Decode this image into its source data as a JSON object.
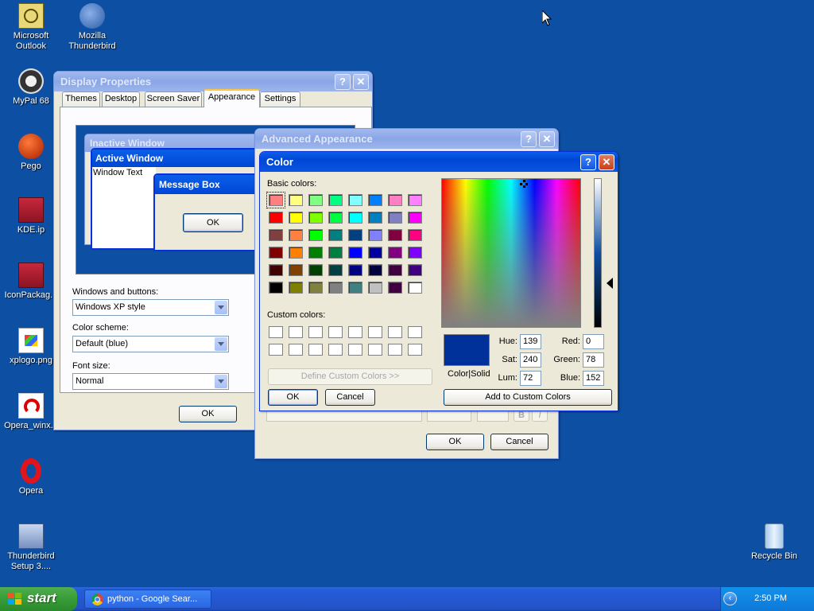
{
  "desktop": {
    "icons": [
      {
        "label": "Microsoft Outlook"
      },
      {
        "label": "Mozilla Thunderbird"
      },
      {
        "label": "MyPal 68"
      },
      {
        "label": "Pego"
      },
      {
        "label": "KDE.ip"
      },
      {
        "label": "IconPackag..."
      },
      {
        "label": "xplogo.png"
      },
      {
        "label": "Opera_winx..."
      },
      {
        "label": "Opera"
      },
      {
        "label": "Thunderbird Setup 3...."
      },
      {
        "label": "Recycle Bin"
      }
    ]
  },
  "display_properties": {
    "title": "Display Properties",
    "tabs": [
      "Themes",
      "Desktop",
      "Screen Saver",
      "Appearance",
      "Settings"
    ],
    "selected_tab": "Appearance",
    "preview": {
      "inactive_title": "Inactive Window",
      "active_title": "Active Window",
      "window_text": "Window Text",
      "message_box_title": "Message Box",
      "message_ok": "OK"
    },
    "windows_buttons_label": "Windows and buttons:",
    "windows_buttons_value": "Windows XP style",
    "color_scheme_label": "Color scheme:",
    "color_scheme_value": "Default (blue)",
    "font_size_label": "Font size:",
    "font_size_value": "Normal",
    "ok": "OK"
  },
  "advanced_appearance": {
    "title": "Advanced Appearance",
    "ok": "OK",
    "cancel": "Cancel",
    "bold_button": "B",
    "italic_button": "I"
  },
  "color_dialog": {
    "title": "Color",
    "basic_colors_label": "Basic colors:",
    "basic_colors": [
      [
        "#ff8080",
        "#ffff80",
        "#80ff80",
        "#00ff80",
        "#80ffff",
        "#0080ff",
        "#ff80c0",
        "#ff80ff"
      ],
      [
        "#ff0000",
        "#ffff00",
        "#80ff00",
        "#00ff40",
        "#00ffff",
        "#0080c0",
        "#8080c0",
        "#ff00ff"
      ],
      [
        "#804040",
        "#ff8040",
        "#00ff00",
        "#008080",
        "#004080",
        "#8080ff",
        "#800040",
        "#ff0080"
      ],
      [
        "#800000",
        "#ff8000",
        "#008000",
        "#008040",
        "#0000ff",
        "#0000a0",
        "#800080",
        "#8000ff"
      ],
      [
        "#400000",
        "#804000",
        "#004000",
        "#004040",
        "#000080",
        "#000040",
        "#400040",
        "#400080"
      ],
      [
        "#000000",
        "#808000",
        "#808040",
        "#808080",
        "#408080",
        "#c0c0c0",
        "#400040",
        "#ffffff"
      ]
    ],
    "custom_colors_label": "Custom colors:",
    "define_custom": "Define Custom Colors >>",
    "ok": "OK",
    "cancel": "Cancel",
    "add_custom": "Add to Custom Colors",
    "color_solid": "Color|Solid",
    "preview_color": "#00309a",
    "hue_label": "Hue:",
    "hue": "139",
    "sat_label": "Sat:",
    "sat": "240",
    "lum_label": "Lum:",
    "lum": "72",
    "red_label": "Red:",
    "red": "0",
    "green_label": "Green:",
    "green": "78",
    "blue_label": "Blue:",
    "blue": "152"
  },
  "taskbar": {
    "start": "start",
    "task_label": "python - Google Sear...",
    "clock": "2:50 PM"
  }
}
